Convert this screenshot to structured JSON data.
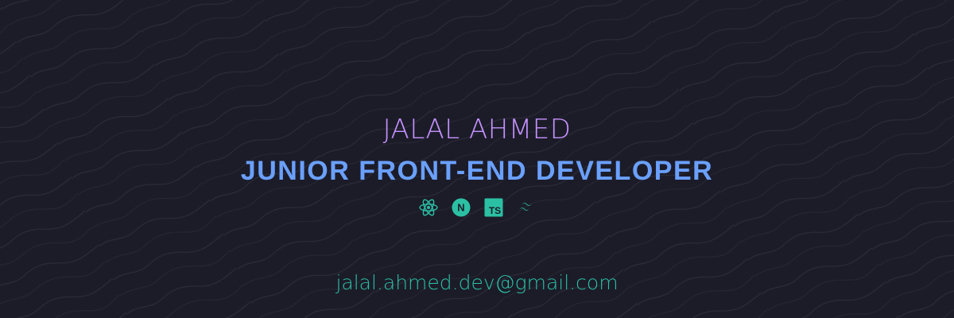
{
  "banner": {
    "name": "JALAL AHMED",
    "role": "JUNIOR FRONT-END DEVELOPER",
    "email": "jalal.ahmed.dev@gmail.com",
    "icons": [
      "react-icon",
      "nextjs-icon",
      "typescript-icon",
      "tailwind-icon"
    ],
    "ts_badge_text": "TS",
    "next_badge_text": "N",
    "colors": {
      "background": "#1c1c29",
      "name": "#c592ff",
      "role": "#6aa0ff",
      "accent": "#2bc0a4"
    }
  }
}
